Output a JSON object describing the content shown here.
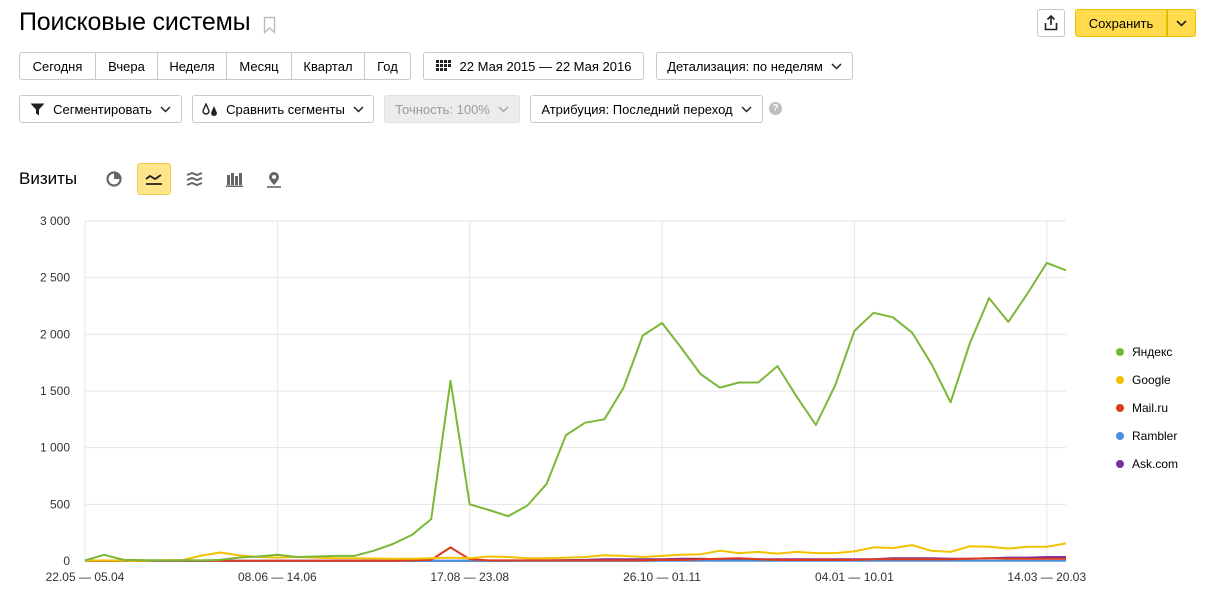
{
  "page": {
    "title": "Поисковые системы"
  },
  "toolbar": {
    "save_label": "Сохранить"
  },
  "periods": [
    "Сегодня",
    "Вчера",
    "Неделя",
    "Месяц",
    "Квартал",
    "Год"
  ],
  "date_range": "22 Мая 2015 — 22 Мая 2016",
  "detail": "Детализация: по неделям",
  "segment": "Сегментировать",
  "compare": "Сравнить сегменты",
  "accuracy": "Точность: 100%",
  "attribution": "Атрибуция: Последний переход",
  "help": "?",
  "metric_label": "Визиты",
  "chart_types": [
    "pie-chart-icon",
    "line-chart-icon",
    "area-chart-icon",
    "bar-chart-icon",
    "map-icon"
  ],
  "active_chart_type": "line-chart-icon",
  "chart_data": {
    "type": "line",
    "ylim": [
      0,
      3000
    ],
    "y_ticks": [
      0,
      500,
      1000,
      1500,
      2000,
      2500,
      3000
    ],
    "y_tick_labels": [
      "0",
      "500",
      "1 000",
      "1 500",
      "2 000",
      "2 500",
      "3 000"
    ],
    "x_tick_labels": [
      "22.05 — 05.04",
      "08.06 — 14.06",
      "17.08 — 23.08",
      "26.10 — 01.11",
      "04.01 — 10.01",
      "14.03 — 20.03"
    ],
    "x_tick_index": [
      0,
      10,
      20,
      30,
      40,
      50
    ],
    "series": [
      {
        "name": "Яндекс",
        "color": "#7ab837",
        "values": [
          5,
          55,
          10,
          8,
          5,
          8,
          5,
          10,
          30,
          40,
          55,
          35,
          40,
          45,
          45,
          90,
          150,
          230,
          370,
          1590,
          500,
          450,
          395,
          490,
          680,
          1110,
          1220,
          1250,
          1530,
          1990,
          2100,
          1880,
          1650,
          1530,
          1575,
          1575,
          1720,
          1450,
          1200,
          1550,
          2030,
          2190,
          2150,
          2015,
          1740,
          1400,
          1920,
          2320,
          2110,
          2360,
          2630,
          2565
        ]
      },
      {
        "name": "Google",
        "color": "#f2c200",
        "values": [
          3,
          5,
          3,
          3,
          8,
          5,
          45,
          75,
          50,
          35,
          30,
          35,
          30,
          25,
          25,
          22,
          20,
          20,
          25,
          30,
          25,
          40,
          35,
          25,
          25,
          30,
          35,
          50,
          45,
          35,
          45,
          55,
          60,
          90,
          70,
          80,
          65,
          80,
          70,
          70,
          85,
          120,
          115,
          140,
          90,
          80,
          130,
          125,
          110,
          125,
          125,
          155
        ]
      },
      {
        "name": "Mail.ru",
        "color": "#e0391c",
        "values": [
          2,
          2,
          2,
          2,
          2,
          2,
          2,
          2,
          2,
          2,
          2,
          2,
          2,
          2,
          2,
          2,
          2,
          5,
          10,
          120,
          15,
          5,
          5,
          5,
          5,
          5,
          5,
          5,
          5,
          5,
          10,
          10,
          15,
          20,
          25,
          15,
          10,
          10,
          10,
          10,
          10,
          15,
          15,
          15,
          15,
          15,
          20,
          25,
          20,
          20,
          20,
          20
        ]
      },
      {
        "name": "Rambler",
        "color": "#4a90d9",
        "values": [
          1,
          1,
          1,
          1,
          1,
          1,
          1,
          1,
          1,
          1,
          1,
          1,
          1,
          1,
          1,
          1,
          1,
          1,
          1,
          1,
          1,
          1,
          1,
          1,
          1,
          1,
          1,
          1,
          1,
          1,
          2,
          2,
          2,
          2,
          2,
          2,
          2,
          2,
          2,
          2,
          2,
          2,
          2,
          2,
          2,
          2,
          2,
          3,
          3,
          3,
          3,
          3
        ]
      },
      {
        "name": "Ask.com",
        "color": "#7b2fa0",
        "values": [
          1,
          1,
          1,
          1,
          1,
          1,
          1,
          1,
          1,
          1,
          2,
          2,
          2,
          2,
          2,
          2,
          2,
          2,
          2,
          2,
          3,
          3,
          3,
          5,
          5,
          8,
          10,
          15,
          15,
          15,
          15,
          20,
          20,
          15,
          15,
          15,
          15,
          15,
          15,
          15,
          15,
          15,
          25,
          25,
          25,
          20,
          20,
          25,
          30,
          30,
          35,
          35
        ]
      }
    ]
  }
}
